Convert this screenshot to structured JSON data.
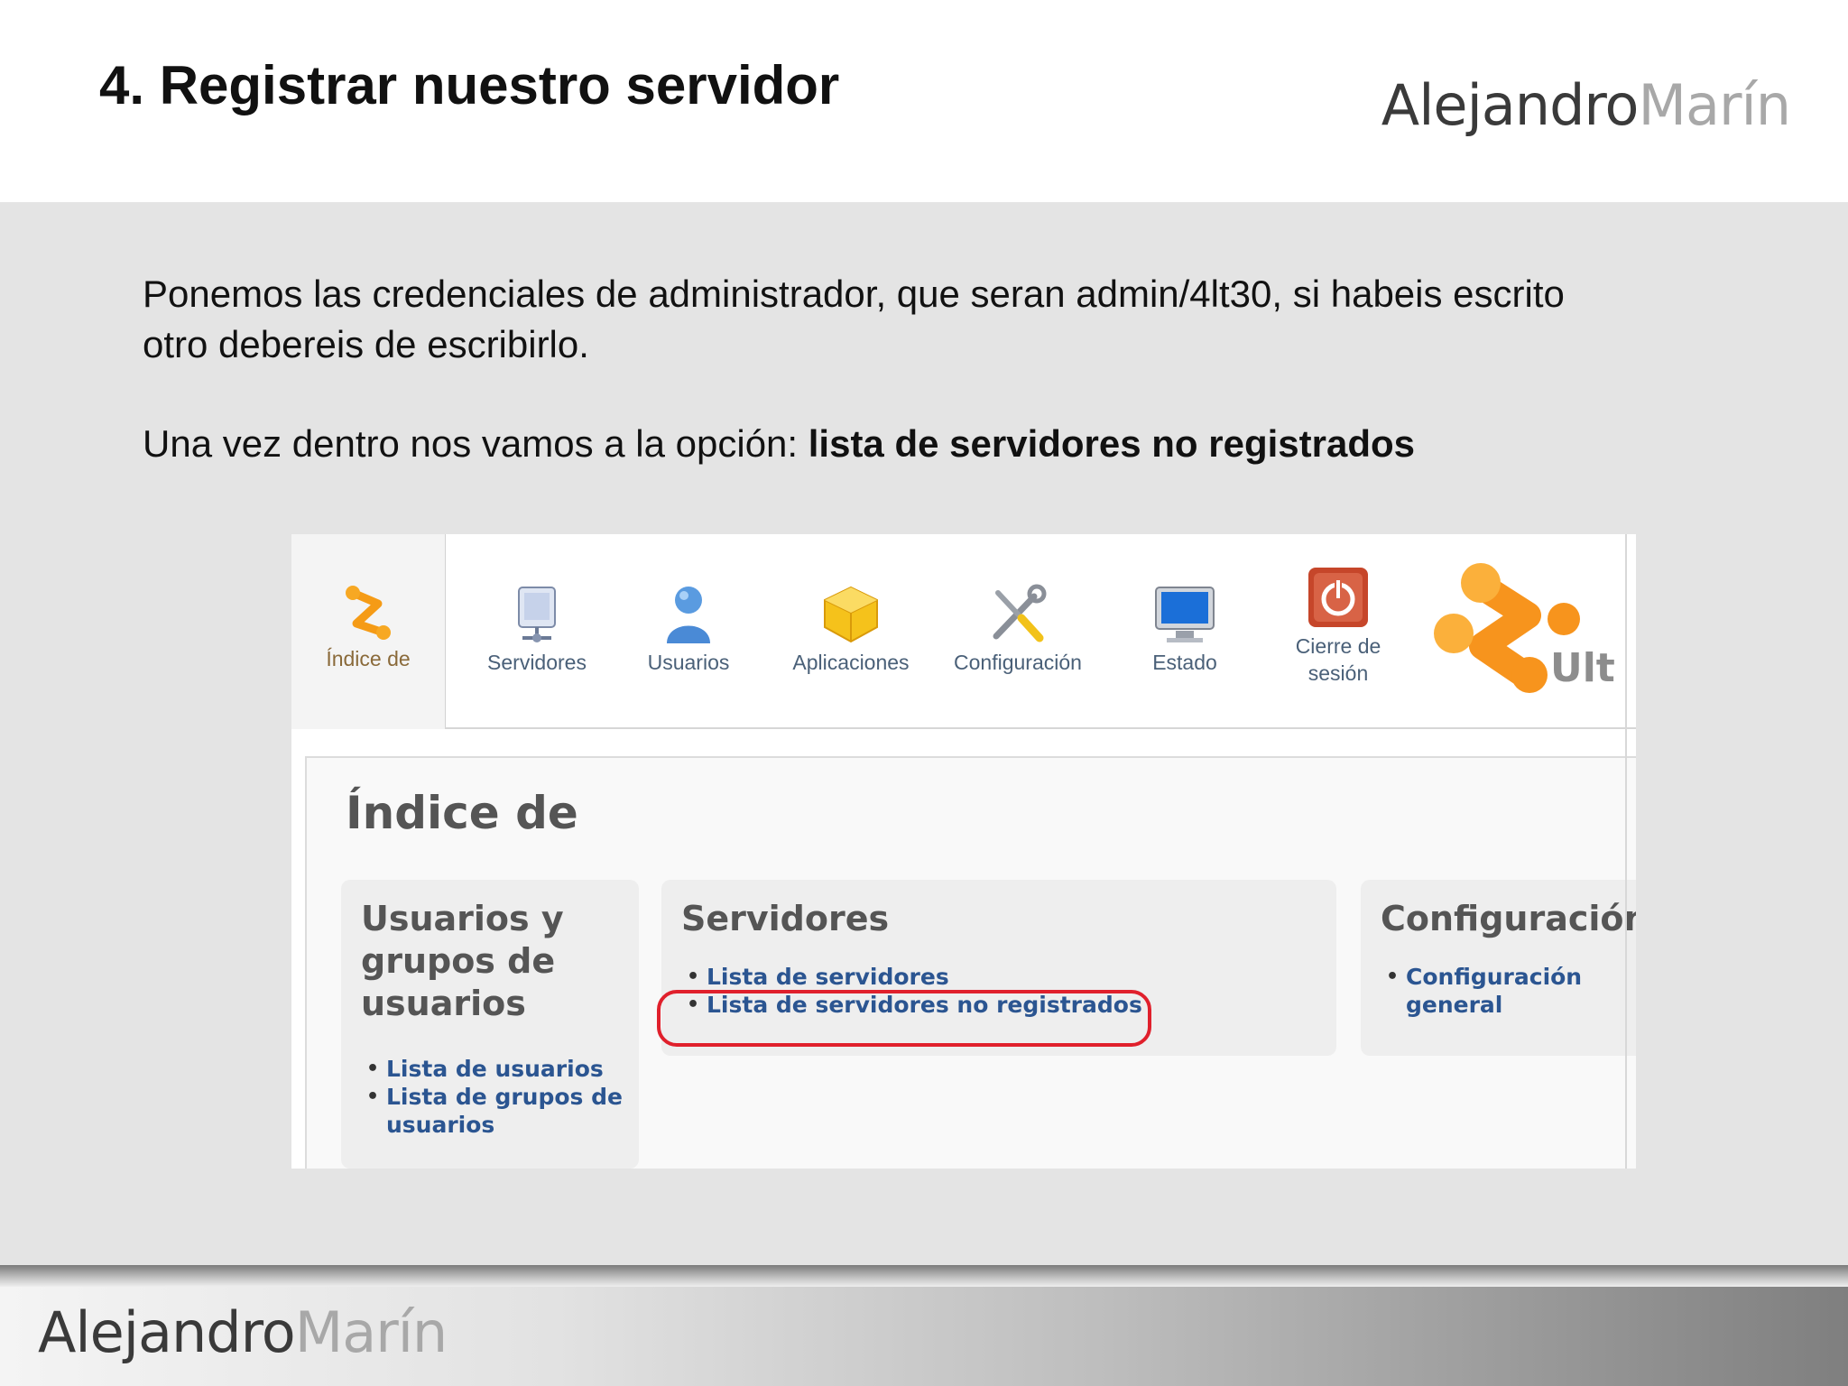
{
  "slide": {
    "title": "4. Registrar nuestro servidor",
    "brand_first": "Alejandro",
    "brand_last": "Marín",
    "paragraph1": "Ponemos las credenciales de administrador, que  seran admin/4lt30, si habeis escrito otro debereis de escribirlo.",
    "paragraph2_plain": "Una vez dentro nos vamos a la opción: ",
    "paragraph2_bold": "lista de servidores no registrados"
  },
  "app": {
    "toolbar": [
      {
        "label": "Índice de",
        "icon": "index-logo-icon"
      },
      {
        "label": "Servidores",
        "icon": "server-icon"
      },
      {
        "label": "Usuarios",
        "icon": "user-icon"
      },
      {
        "label": "Aplicaciones",
        "icon": "package-icon"
      },
      {
        "label": "Configuración",
        "icon": "tools-icon"
      },
      {
        "label": "Estado",
        "icon": "monitor-icon"
      },
      {
        "label": "Cierre de sesión",
        "icon": "power-icon"
      }
    ],
    "brand_partial": "Ult",
    "page_heading": "Índice de",
    "cards": [
      {
        "title": "Usuarios y grupos de usuarios",
        "links": [
          "Lista de usuarios",
          "Lista de grupos de usuarios"
        ]
      },
      {
        "title": "Servidores",
        "links": [
          "Lista de servidores",
          "Lista de servidores no registrados"
        ]
      },
      {
        "title": "Configuración",
        "links": [
          "Configuración general"
        ]
      }
    ],
    "highlight_color": "#e0202c",
    "link_color": "#2b5591"
  }
}
